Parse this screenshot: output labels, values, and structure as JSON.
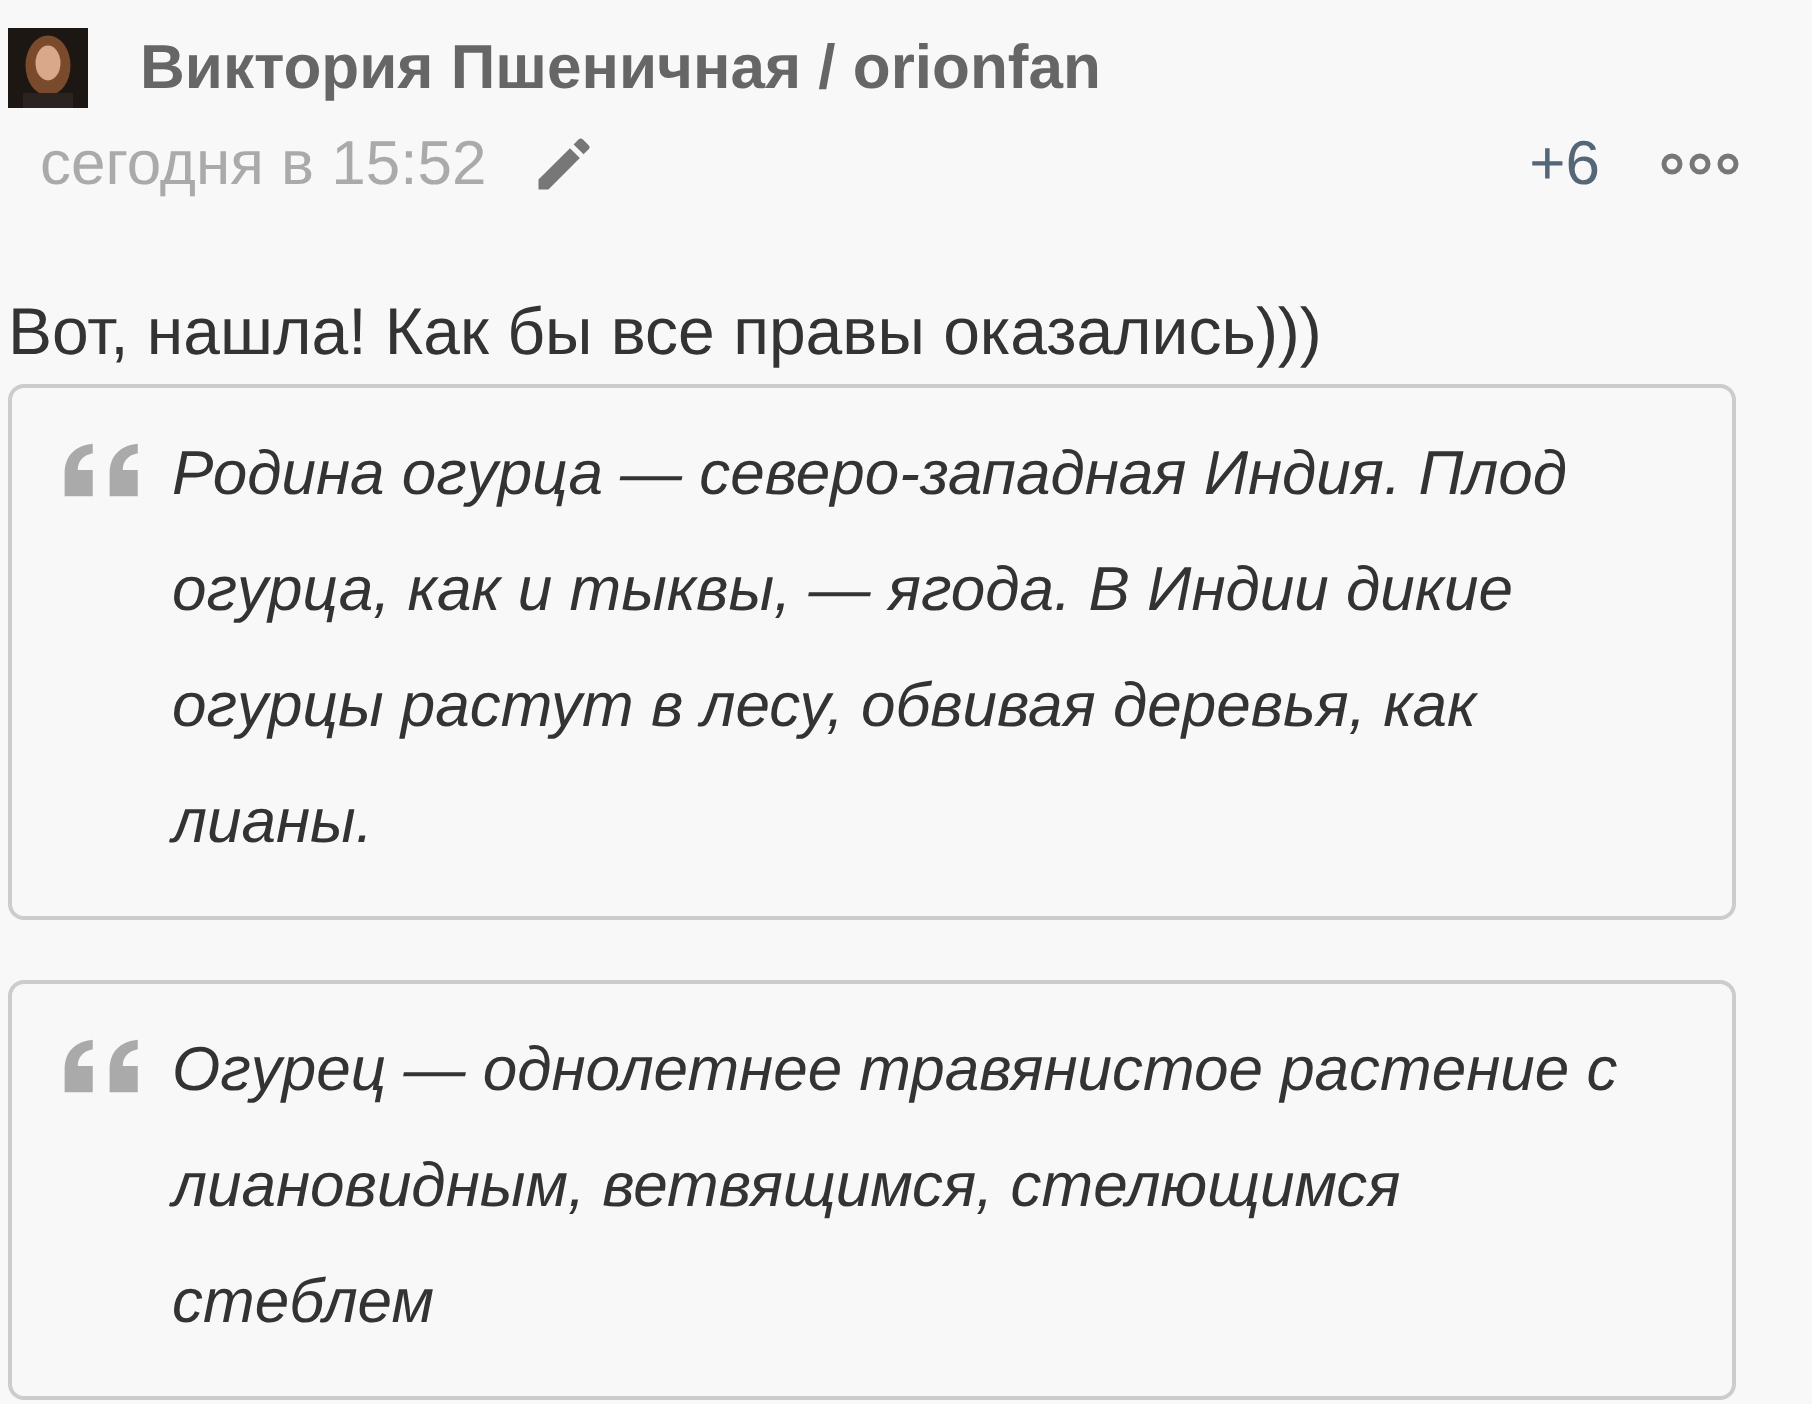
{
  "post": {
    "author": "Виктория Пшеничная / orionfan",
    "time": "сегодня в 15:52",
    "score": "+6",
    "text": "Вот, нашла! Как бы все правы оказались)))",
    "quotes": [
      {
        "text": "Родина огурца — северо-западная Индия. Плод огурца, как и тыквы, — ягода. В Индии дикие огурцы растут в лесу, обвивая деревья, как лианы."
      },
      {
        "text": "Огурец — однолетнее травянистое растение с лиановидным, ветвящимся, стелющимся стеблем"
      }
    ]
  }
}
